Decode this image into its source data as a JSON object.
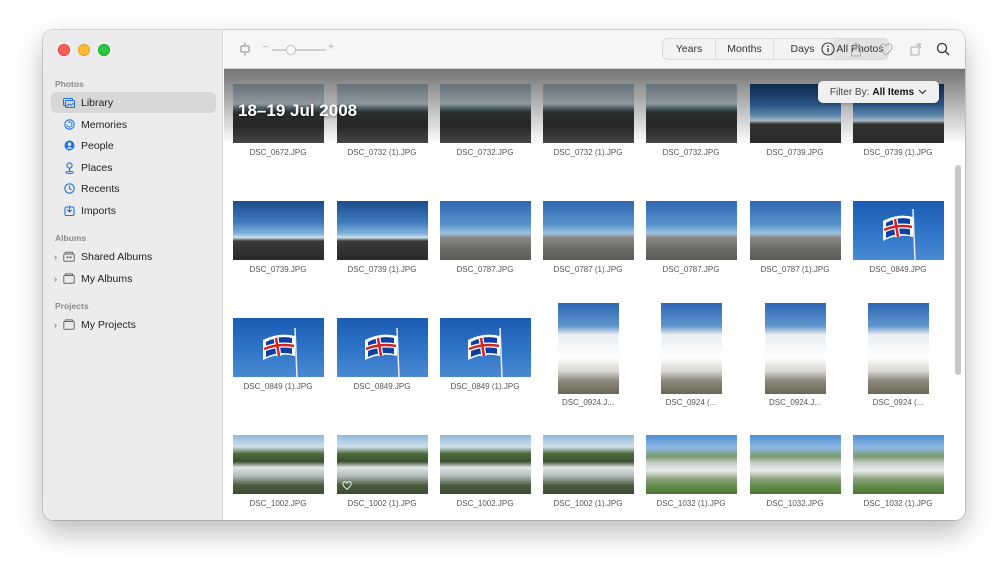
{
  "sidebar": {
    "sections": {
      "photos": "Photos",
      "albums": "Albums",
      "projects": "Projects"
    },
    "items": [
      {
        "label": "Library",
        "icon": "library-icon"
      },
      {
        "label": "Memories",
        "icon": "memories-icon"
      },
      {
        "label": "People",
        "icon": "people-icon"
      },
      {
        "label": "Places",
        "icon": "places-icon"
      },
      {
        "label": "Recents",
        "icon": "recents-icon"
      },
      {
        "label": "Imports",
        "icon": "imports-icon"
      },
      {
        "label": "Shared Albums",
        "icon": "shared-albums-icon"
      },
      {
        "label": "My Albums",
        "icon": "folder-icon"
      },
      {
        "label": "My Projects",
        "icon": "folder-icon"
      }
    ]
  },
  "toolbar": {
    "tabs": [
      "Years",
      "Months",
      "Days",
      "All Photos"
    ],
    "selected_tab": "All Photos",
    "zoom_minus": "−",
    "zoom_plus": "+"
  },
  "content": {
    "date_title": "18–19 Jul 2008",
    "filter": {
      "label": "Filter By:",
      "value": "All Items"
    },
    "rows": [
      [
        "DSC_0672.JPG",
        "DSC_0732 (1).JPG",
        "DSC_0732.JPG",
        "DSC_0732 (1).JPG",
        "DSC_0732.JPG",
        "DSC_0739.JPG",
        "DSC_0739 (1).JPG"
      ],
      [
        "DSC_0739.JPG",
        "DSC_0739 (1).JPG",
        "DSC_0787.JPG",
        "DSC_0787 (1).JPG",
        "DSC_0787.JPG",
        "DSC_0787 (1).JPG",
        "DSC_0849.JPG"
      ],
      [
        "DSC_0849 (1).JPG",
        "DSC_0849.JPG",
        "DSC_0849 (1).JPG",
        "DSC_0924.J...",
        "DSC_0924 (...",
        "DSC_0924.J...",
        "DSC_0924 (..."
      ],
      [
        "DSC_1002.JPG",
        "DSC_1002 (1).JPG",
        "DSC_1002.JPG",
        "DSC_1002 (1).JPG",
        "DSC_1032 (1).JPG",
        "DSC_1032.JPG",
        "DSC_1032 (1).JPG"
      ]
    ]
  },
  "colors": {
    "accent": "#1d76e1",
    "sidebar_bg": "#ececec",
    "selected_bg": "#d7d7d7"
  }
}
